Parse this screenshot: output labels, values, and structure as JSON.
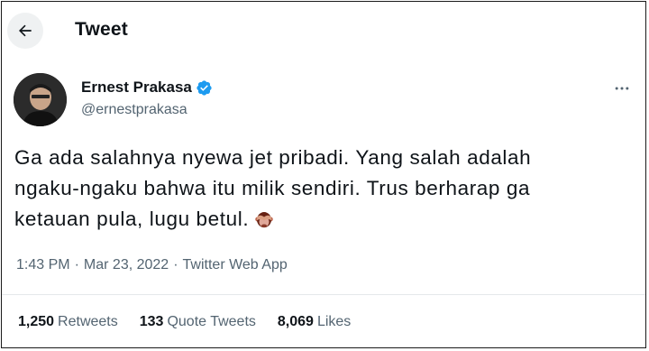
{
  "header": {
    "back_icon": "arrow-left-icon",
    "title": "Tweet"
  },
  "author": {
    "name": "Ernest Prakasa",
    "handle": "@ernestprakasa",
    "verified": true,
    "verified_color": "#1d9bf0"
  },
  "tweet": {
    "lines": [
      "Ga ada salahnya nyewa jet pribadi. Yang salah adalah",
      "ngaku-ngaku bahwa itu milik sendiri. Trus berharap ga",
      "ketauan pula, lugu betul."
    ],
    "emoji": "see-no-evil-monkey-icon"
  },
  "meta": {
    "time": "1:43 PM",
    "separator": "·",
    "date": "Mar 23, 2022",
    "source": "Twitter Web App"
  },
  "stats": {
    "retweets_count": "1,250",
    "retweets_label": "Retweets",
    "quotes_count": "133",
    "quotes_label": "Quote Tweets",
    "likes_count": "8,069",
    "likes_label": "Likes"
  }
}
